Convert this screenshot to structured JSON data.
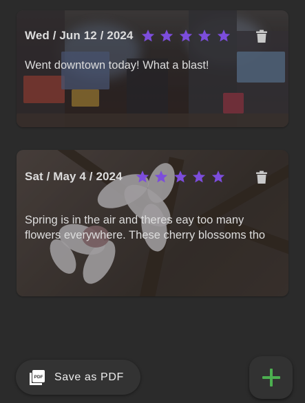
{
  "entries": [
    {
      "date": "Wed / Jun 12 / 2024",
      "rating": 5,
      "max_rating": 5,
      "text": "Went downtown today! What a blast!",
      "image_subject": "city-street-billboards"
    },
    {
      "date": "Sat / May 4 / 2024",
      "rating": 5,
      "max_rating": 5,
      "text": "Spring is in the air and theres eay too many flowers everywhere. These cherry blossoms tho",
      "image_subject": "cherry-blossoms"
    }
  ],
  "actions": {
    "save_pdf_label": "Save as PDF",
    "save_pdf_icon": "pdf-icon",
    "add_icon": "plus-icon",
    "delete_icon": "trash-icon"
  },
  "colors": {
    "background": "#2b2b2b",
    "star": "#7c4ddc",
    "add_plus": "#4caf50",
    "text": "#dddddd"
  }
}
